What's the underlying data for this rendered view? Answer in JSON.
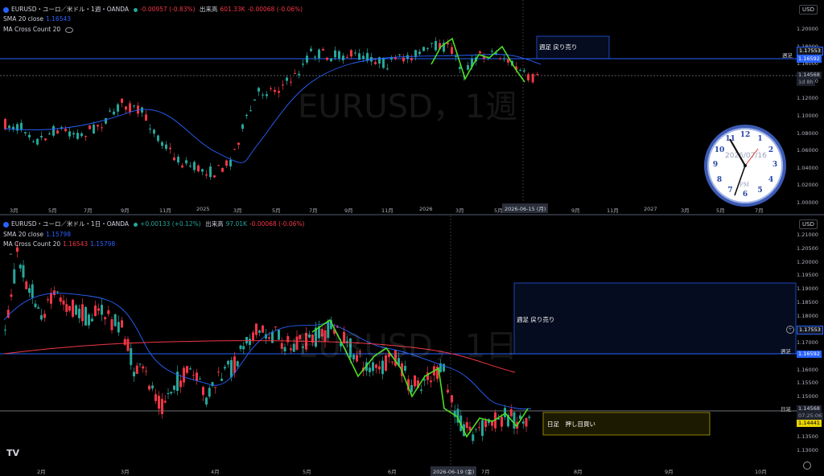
{
  "top": {
    "symbol": "EURUSD・ユーロ／米ドル・1週・OANDA",
    "change": "-0.00957 (-0.83%)",
    "volume_label": "出来高",
    "volume": "601.33K",
    "volume_change": "-0.00068 (-0.06%)",
    "sma_label": "SMA 20 close",
    "sma_value": "1.16543",
    "macc_label": "MA Cross Count 20",
    "currency": "USD",
    "watermark": "EURUSD，1週",
    "price_axis": [
      "1.20000",
      "1.18000",
      "1.16000",
      "1.14000",
      "1.12000",
      "1.10000",
      "1.08000",
      "1.06000",
      "1.04000",
      "1.02000",
      "1.00000"
    ],
    "x_axis": [
      "3月",
      "5月",
      "7月",
      "9月",
      "11月",
      "2025",
      "3月",
      "5月",
      "7月",
      "9月",
      "11月",
      "2026",
      "3月",
      "5月",
      "9月",
      "11月",
      "2027",
      "3月",
      "5月",
      "7月"
    ],
    "crosshair_date": "2026-06-15 (月)",
    "tag_1": "1.17553",
    "tag_2": "1.16592",
    "tag_3": "1.14568",
    "tag_3_sub": "1d 8h",
    "zone_label": "週足 戻り売り",
    "side_label": "週足",
    "clock_date": "2026/07/16",
    "clock_ampm": "PM",
    "clock_numbers": [
      "12",
      "1",
      "2",
      "3",
      "4",
      "5",
      "6",
      "7",
      "8",
      "9",
      "10",
      "11"
    ]
  },
  "bottom": {
    "symbol": "EURUSD・ユーロ／米ドル・1日・OANDA",
    "change": "+0.00133 (+0.12%)",
    "volume_label": "出来高",
    "volume": "97.01K",
    "volume_change": "-0.00068 (-0.06%)",
    "sma_label": "SMA 20 close",
    "sma_value": "1.15798",
    "macc_label": "MA Cross Count 20",
    "macc_v1": "1.16543",
    "macc_v2": "1.15798",
    "currency": "USD",
    "watermark": "EURUSD，1日",
    "price_axis": [
      "1.21000",
      "1.20500",
      "1.20000",
      "1.19500",
      "1.19000",
      "1.18500",
      "1.18000",
      "1.17500",
      "1.17000",
      "1.16500",
      "1.16000",
      "1.15500",
      "1.15000",
      "1.14500",
      "1.14000",
      "1.13500",
      "1.13000"
    ],
    "x_axis": [
      "2月",
      "3月",
      "4月",
      "5月",
      "6月",
      "7月",
      "8月",
      "9月",
      "10月"
    ],
    "crosshair_date": "2026-06-19 (金)",
    "tag_1": "1.17553",
    "tag_2": "1.16592",
    "tag_3": "1.14568",
    "tag_3_sub": "07:25:06",
    "tag_4": "1.14441",
    "zone_top_label": "週足 戻り売り",
    "zone_bot_label": "日足　押し目買い",
    "side_label_1": "週足",
    "side_label_2": "日足",
    "logo": "TV"
  },
  "colors": {
    "up": "#26a69a",
    "down": "#f23645",
    "sma": "#2962ff",
    "ma_red": "#f23645",
    "zigzag": "#4cdf21",
    "zone_blue": "#1d2e66",
    "zone_yellow": "#5a5000"
  }
}
